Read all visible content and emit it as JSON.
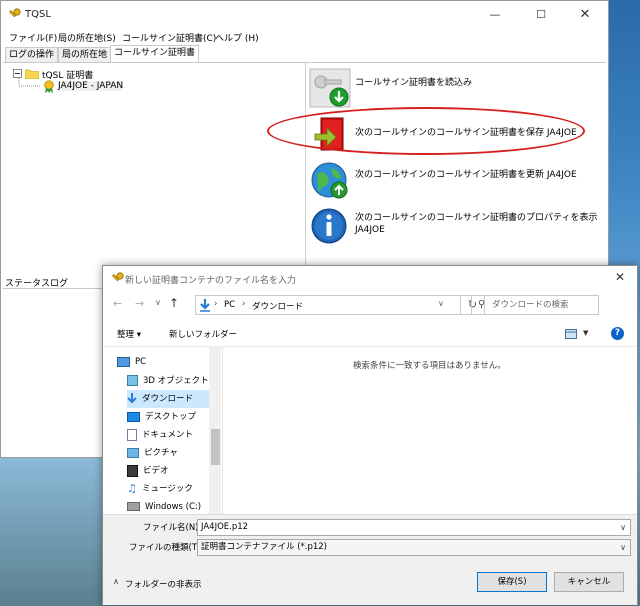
{
  "tqsl": {
    "title": "TQSL",
    "menu": [
      "ファイル(F)",
      "局の所在地(S)",
      "コールサイン証明書(C)",
      "ヘルプ (H)"
    ],
    "tabs": [
      "ログの操作",
      "局の所在地",
      "コールサイン証明書"
    ],
    "tree": {
      "root": "tQSL 証明書",
      "child": "JA4JOE - JAPAN"
    },
    "actions": [
      {
        "label": "コールサイン証明書を読込み"
      },
      {
        "label": "次のコールサインのコールサイン証明書を保存 JA4JOE"
      },
      {
        "label": "次のコールサインのコールサイン証明書を更新 JA4JOE"
      },
      {
        "label": "次のコールサインのコールサイン証明書のプロパティを表示",
        "label2": "JA4JOE"
      }
    ],
    "status_log_title": "ステータスログ"
  },
  "dialog": {
    "title": "新しい証明書コンテナのファイル名を入力",
    "path": [
      "PC",
      "ダウンロード"
    ],
    "search_placeholder": "ダウンロードの検索",
    "organize": "整理 ▾",
    "new_folder": "新しいフォルダー",
    "nav_items": [
      "PC",
      "3D オブジェクト",
      "ダウンロード",
      "デスクトップ",
      "ドキュメント",
      "ピクチャ",
      "ビデオ",
      "ミュージック",
      "Windows (C:)"
    ],
    "empty_message": "検索条件に一致する項目はありません。",
    "filename_label": "ファイル名(N):",
    "filename_value": "JA4JOE.p12",
    "filetype_label": "ファイルの種類(T):",
    "filetype_value": "証明書コンテナファイル (*.p12)",
    "hide_folders": "フォルダーの非表示",
    "save": "保存(S)",
    "cancel": "キャンセル"
  },
  "colors": {
    "highlight_ellipse": "#d42020",
    "selection": "#cce8ff",
    "accent": "#0078d7"
  }
}
